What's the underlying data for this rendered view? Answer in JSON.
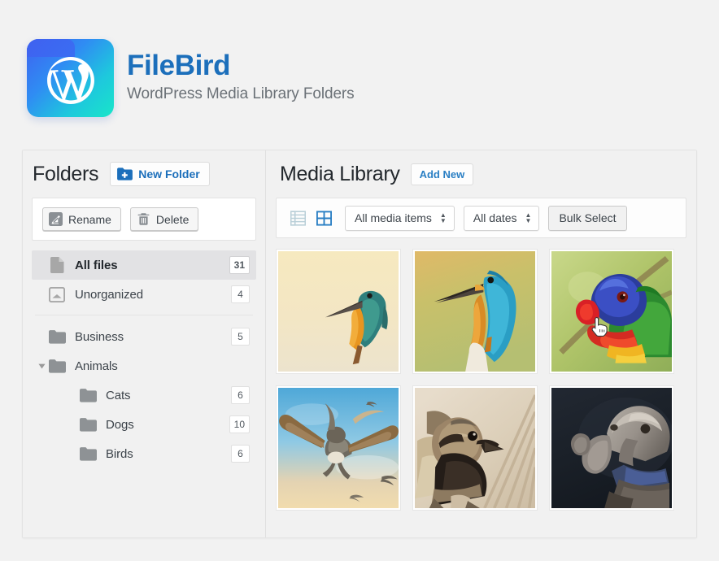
{
  "brand": {
    "title": "FileBird",
    "subtitle": "WordPress Media Library Folders",
    "logo_icon": "wordpress-folder-logo",
    "colors": {
      "title": "#1c6fbb",
      "subtitle": "#6b7177",
      "logo_gradient_from": "#3f61f0",
      "logo_gradient_to": "#18e6c8"
    }
  },
  "folders_panel": {
    "title": "Folders",
    "new_folder_label": "New Folder",
    "new_folder_icon": "folder-plus-icon",
    "actions": [
      {
        "label": "Rename",
        "icon": "pencil-icon"
      },
      {
        "label": "Delete",
        "icon": "trash-icon"
      }
    ],
    "tree": [
      {
        "label": "All files",
        "count": "31",
        "icon": "file-icon",
        "indent": 0,
        "selected": true,
        "twisty": "none"
      },
      {
        "label": "Unorganized",
        "count": "4",
        "icon": "inbox-icon",
        "indent": 0,
        "selected": false,
        "twisty": "none"
      },
      {
        "label": "Business",
        "count": "5",
        "icon": "folder-icon",
        "indent": 0,
        "selected": false,
        "twisty": "none"
      },
      {
        "label": "Animals",
        "count": "",
        "icon": "folder-icon",
        "indent": 0,
        "selected": false,
        "twisty": "expanded"
      },
      {
        "label": "Cats",
        "count": "6",
        "icon": "folder-icon",
        "indent": 1,
        "selected": false,
        "twisty": "none"
      },
      {
        "label": "Dogs",
        "count": "10",
        "icon": "folder-icon",
        "indent": 1,
        "selected": false,
        "twisty": "none"
      },
      {
        "label": "Birds",
        "count": "6",
        "icon": "folder-icon",
        "indent": 1,
        "selected": false,
        "twisty": "none"
      }
    ]
  },
  "media_panel": {
    "title": "Media Library",
    "add_new_label": "Add New",
    "toolbar": {
      "view_list_icon": "list-view-icon",
      "view_grid_icon": "grid-view-icon",
      "active_view": "grid",
      "media_filter_value": "All media items",
      "date_filter_value": "All dates",
      "bulk_select_label": "Bulk Select"
    },
    "items": [
      {
        "alt": "Kingfisher perched on branch, cream background",
        "art": "kingfisher-cream"
      },
      {
        "alt": "Blue kingfisher on olive background",
        "art": "kingfisher-olive"
      },
      {
        "alt": "Rainbow lorikeet close-up",
        "art": "lorikeet"
      },
      {
        "alt": "Seagulls flying in blue sky",
        "art": "seagulls"
      },
      {
        "alt": "Sparrow on wooden background",
        "art": "sparrow"
      },
      {
        "alt": "Weimaraner dog with blue collar, dark backdrop",
        "art": "dog"
      }
    ]
  },
  "cursor": {
    "icon": "pointing-hand-cursor"
  }
}
